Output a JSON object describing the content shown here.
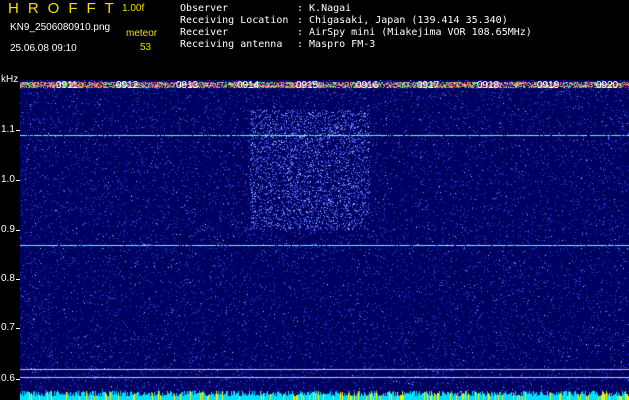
{
  "header": {
    "app_title": "HROFFT",
    "version": "1.00f",
    "filename": "KN9_2506080910.png",
    "meteor_label": "meteor",
    "datetime": "25.06.08 09:10",
    "meteor_count": "53",
    "info": [
      {
        "key": "Observer",
        "value": ": K.Nagai"
      },
      {
        "key": "Receiving Location",
        "value": ": Chigasaki, Japan (139.414 35.340)"
      },
      {
        "key": "Receiver",
        "value": ": AirSpy mini (Miakejima VOR 108.65MHz)"
      },
      {
        "key": "Receiving antenna",
        "value": ": Maspro FM-3"
      }
    ]
  },
  "axis": {
    "y_unit": "kHz",
    "y_ticks": [
      "1.1",
      "1.0",
      "0.9",
      "0.8",
      "0.7",
      "0.6"
    ],
    "x_ticks": [
      "0911",
      "0912",
      "0913",
      "0914",
      "0915",
      "0916",
      "0917",
      "0918",
      "0919",
      "0920"
    ]
  },
  "colors": {
    "background": "#000060",
    "noise": "#3050ff",
    "carrier": "#40ffc0",
    "top_band": "#ff40a0",
    "bottom_band": "#00e0ff",
    "title_yellow": "#f0e000"
  },
  "signals": {
    "carrier_lines_khz": [
      1.09,
      0.87
    ],
    "reference_lines_khz": [
      0.62,
      0.605
    ]
  }
}
